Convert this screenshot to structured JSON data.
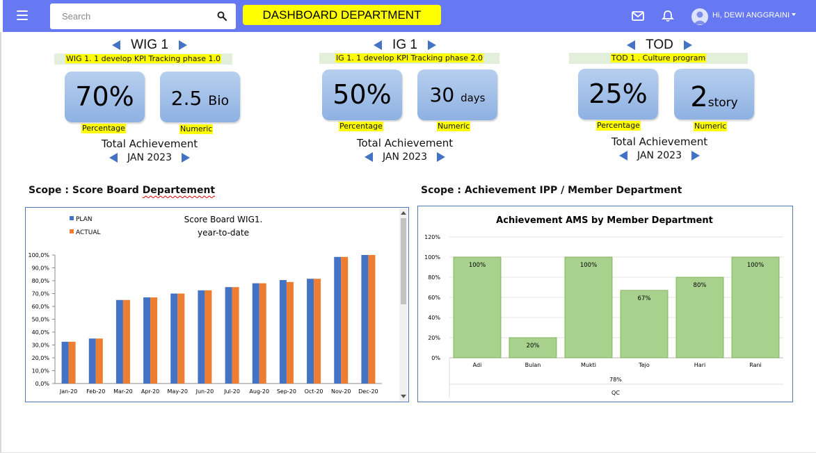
{
  "header": {
    "search_placeholder": "Search",
    "title": "DASHBOARD DEPARTMENT",
    "user_name": "Hi, DEWI ANGGRAINI",
    "icons": [
      "menu-icon",
      "search-icon",
      "mail-icon",
      "bell-icon",
      "user-avatar-icon"
    ],
    "accent_color": "#6779f2",
    "title_bg": "#ffff00"
  },
  "kpis": [
    {
      "name": "WIG 1",
      "subtitle": "WIG 1. 1 develop  KPI Tracking phase 1.0",
      "percentage_value": "70%",
      "percentage_label": "Percentage",
      "numeric_value": "2.5",
      "numeric_unit": "Bio",
      "numeric_label": "Numeric",
      "total_label": "Total Achievement",
      "period": "JAN 2023"
    },
    {
      "name": "IG 1",
      "subtitle": "IG 1. 1 develop  KPI Tracking phase 2.0",
      "percentage_value": "50%",
      "percentage_label": "Percentage",
      "numeric_value": "30",
      "numeric_unit": "days",
      "numeric_label": "Numeric",
      "total_label": "Total Achievement",
      "period": "JAN 2023"
    },
    {
      "name": "TOD",
      "subtitle": "TOD 1 . Culture program",
      "percentage_value": "25%",
      "percentage_label": "Percentage",
      "numeric_value": "2",
      "numeric_unit": "story",
      "numeric_label": "Numeric",
      "total_label": "Total Achievement",
      "period": "JAN 2023"
    }
  ],
  "scope_left": {
    "prefix": "Scope : Score Board ",
    "misspelled": "Departement"
  },
  "scope_right": "Scope : Achievement IPP / Member Department",
  "chart_data": [
    {
      "type": "bar",
      "title": "Score Board WIG1.",
      "subtitle": "year-to-date",
      "categories": [
        "Jan-20",
        "Feb-20",
        "Mar-20",
        "Apr-20",
        "May-20",
        "Jun-20",
        "Jul-20",
        "Aug-20",
        "Sep-20",
        "Oct-20",
        "Nov-20",
        "Dec-20"
      ],
      "series": [
        {
          "name": "PLAN",
          "color": "#4472c4",
          "values": [
            32.5,
            35,
            65,
            67,
            70,
            72.5,
            75,
            78,
            80.5,
            81.5,
            98.5,
            100
          ]
        },
        {
          "name": "ACTUAL",
          "color": "#ed7d31",
          "values": [
            32.5,
            35,
            65,
            67,
            70,
            72.5,
            75,
            78,
            79,
            81.5,
            98.5,
            100
          ]
        }
      ],
      "ylim": [
        0,
        100
      ],
      "yticks": [
        "0,0%",
        "10,0%",
        "20,0%",
        "30,0%",
        "40,0%",
        "50,0%",
        "60,0%",
        "70,0%",
        "80,0%",
        "90,0%",
        "100,0%"
      ],
      "legend": "top-left",
      "grid": false
    },
    {
      "type": "bar",
      "title": "Achievement AMS by Member Department",
      "categories": [
        "Adi",
        "Bulan",
        "Mukti",
        "Tejo",
        "Hari",
        "Rani"
      ],
      "values": [
        100,
        20,
        100,
        67,
        80,
        100
      ],
      "data_labels": [
        "100%",
        "20%",
        "100%",
        "67%",
        "80%",
        "100%"
      ],
      "ylim": [
        0,
        120
      ],
      "yticks": [
        "0%",
        "20%",
        "40%",
        "60%",
        "80%",
        "100%",
        "120%"
      ],
      "group_value": "78%",
      "group_label": "QC",
      "bar_color": "#a9d18e",
      "grid": true
    }
  ]
}
